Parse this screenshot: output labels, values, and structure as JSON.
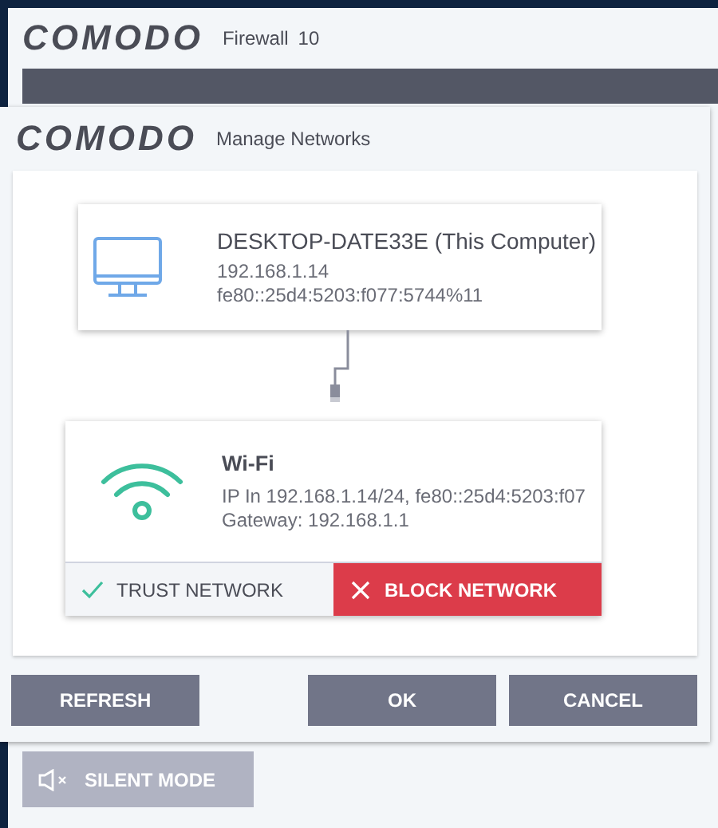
{
  "main_window": {
    "logo": "COMODO",
    "title": "Firewall",
    "version": "10",
    "silent_mode_button": "SILENT MODE"
  },
  "dialog": {
    "logo": "COMODO",
    "title": "Manage Networks",
    "computer": {
      "name": "DESKTOP-DATE33E (This Computer)",
      "ipv4": "192.168.1.14",
      "ipv6": "fe80::25d4:5203:f077:5744%11"
    },
    "network": {
      "name": "Wi-Fi",
      "ip": "IP In 192.168.1.14/24, fe80::25d4:5203:f07",
      "gateway": "Gateway: 192.168.1.1",
      "actions": [
        {
          "kind": "trust",
          "label": "TRUST NETWORK",
          "selected": false
        },
        {
          "kind": "block",
          "label": "BLOCK NETWORK",
          "selected": true
        }
      ]
    },
    "buttons": [
      "REFRESH",
      "OK",
      "CANCEL"
    ]
  }
}
